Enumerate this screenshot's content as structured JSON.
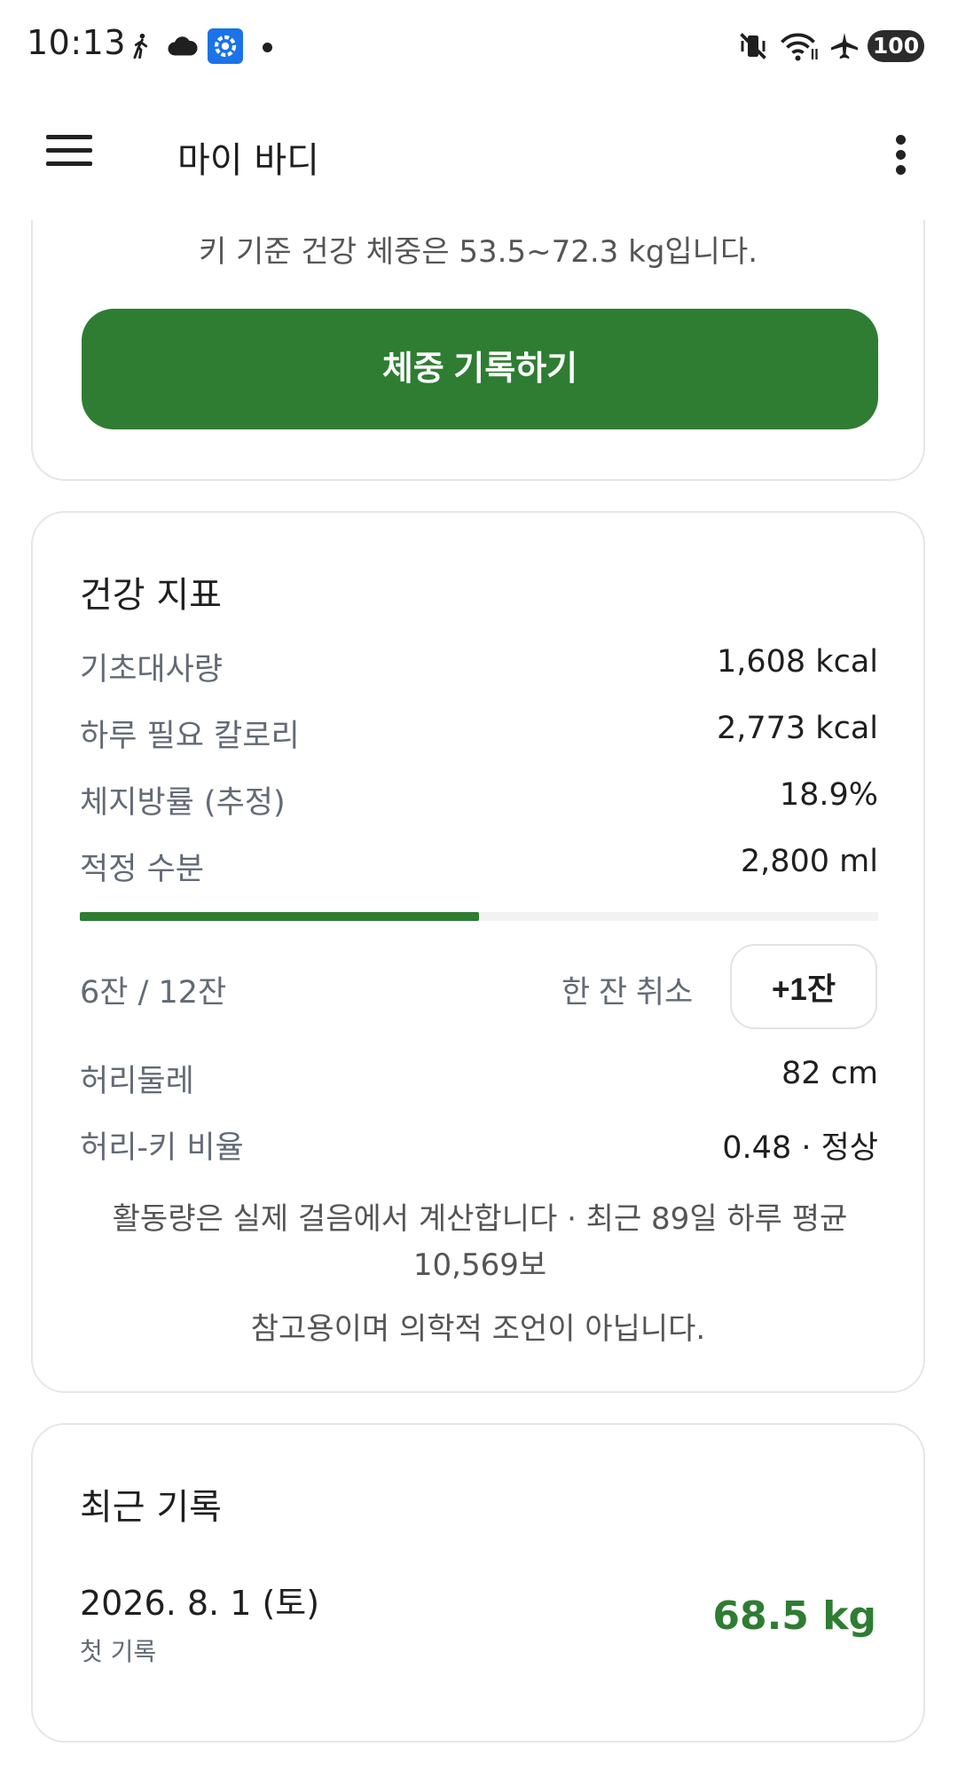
{
  "status_bar": {
    "time": "10:13",
    "battery": "100",
    "icons": [
      "walking-icon",
      "cloud-icon",
      "settings-icon",
      "notification-dot",
      "vibrate-off-icon",
      "wifi-icon",
      "airplane-icon",
      "battery-icon"
    ]
  },
  "app_bar": {
    "title": "마이 바디",
    "menu_icon": "hamburger-menu-icon",
    "more_icon": "more-vert-icon"
  },
  "weight_card": {
    "range_text": "키 기준 건강 체중은 53.5~72.3 kg입니다.",
    "record_button": "체중 기록하기"
  },
  "health_card": {
    "title": "건강 지표",
    "metrics": [
      {
        "label": "기초대사량",
        "value": "1,608 kcal"
      },
      {
        "label": "하루 필요 칼로리",
        "value": "2,773 kcal"
      },
      {
        "label": "체지방률 (추정)",
        "value": "18.9%"
      },
      {
        "label": "적정 수분",
        "value": "2,800 ml"
      }
    ],
    "water": {
      "cups_text": "6잔 / 12잔",
      "progress": 0.5,
      "undo_label": "한 잔 취소",
      "add_label": "+1잔"
    },
    "body_metrics": [
      {
        "label": "허리둘레",
        "value": "82 cm"
      },
      {
        "label": "허리-키 비율",
        "value": "0.48 · 정상"
      }
    ],
    "activity_note": "활동량은 실제 걸음에서 계산합니다 · 최근 89일 하루 평균 10,569보",
    "disclaimer": "참고용이며 의학적 조언이 아닙니다."
  },
  "recent_card": {
    "title": "최근 기록",
    "entries": [
      {
        "date": "2026. 8. 1 (토)",
        "note": "첫 기록",
        "weight": "68.5 kg"
      }
    ]
  },
  "colors": {
    "accent": "#2e7d32",
    "text_primary": "#1f1f1f",
    "text_secondary": "#626a76",
    "card_border": "#e6e6e6"
  }
}
